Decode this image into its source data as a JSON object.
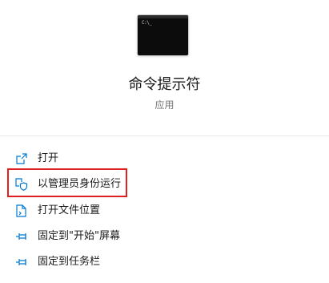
{
  "app": {
    "name": "命令提示符",
    "type": "应用",
    "icon": "command-prompt-icon",
    "icon_prompt_text": "C:\\_"
  },
  "menu": {
    "items": [
      {
        "label": "打开",
        "icon": "open-icon"
      },
      {
        "label": "以管理员身份运行",
        "icon": "run-as-admin-shield-icon",
        "highlighted": true
      },
      {
        "label": "打开文件位置",
        "icon": "file-location-icon"
      },
      {
        "label": "固定到\"开始\"屏幕",
        "icon": "pin-icon"
      },
      {
        "label": "固定到任务栏",
        "icon": "pin-icon"
      }
    ]
  },
  "colors": {
    "accent": "#0078d4",
    "highlight_border": "#e02020",
    "text": "#1a1a1a",
    "subtext": "#767676"
  }
}
